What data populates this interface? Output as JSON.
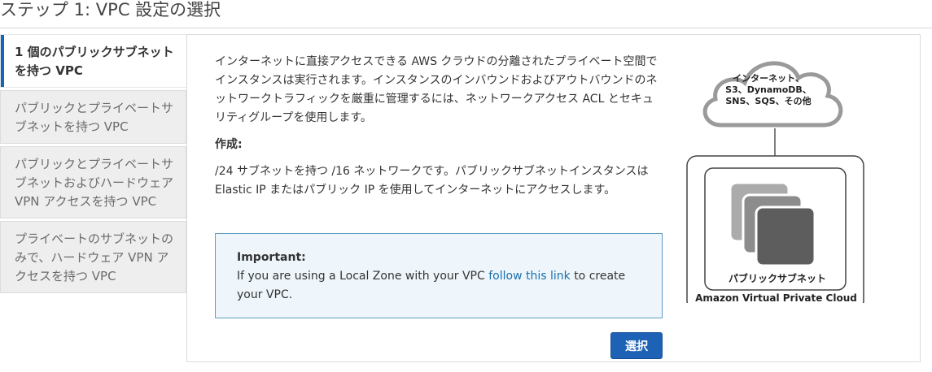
{
  "page": {
    "title": "ステップ 1: VPC 設定の選択"
  },
  "sidebar": {
    "items": [
      {
        "label": "1 個のパブリックサブネットを持つ VPC",
        "active": true
      },
      {
        "label": "パブリックとプライベートサブネットを持つ VPC",
        "active": false
      },
      {
        "label": "パブリックとプライベートサブネットおよびハードウェア VPN アクセスを持つ VPC",
        "active": false
      },
      {
        "label": "プライベートのサブネットのみで、ハードウェア VPN アクセスを持つ VPC",
        "active": false
      }
    ]
  },
  "main": {
    "description": "インターネットに直接アクセスできる AWS クラウドの分離されたプライベート空間でインスタンスは実行されます。インスタンスのインバウンドおよびアウトバウンドのネットワークトラフィックを厳重に管理するには、ネットワークアクセス ACL とセキュリティグループを使用します。",
    "create_label": "作成:",
    "create_text": "/24 サブネットを持つ /16 ネットワークです。パブリックサブネットインスタンスは Elastic IP またはパブリック IP を使用してインターネットにアクセスします。",
    "notice": {
      "heading": "Important:",
      "text_before": "If you are using a Local Zone with your VPC",
      "link": "follow this link",
      "text_after": "to create your VPC."
    },
    "select_button": "選択"
  },
  "diagram": {
    "cloud_line1": "インターネット、",
    "cloud_line2": "S3、DynamoDB、",
    "cloud_line3": "SNS、SQS、その他",
    "subnet_label": "パブリックサブネット",
    "vpc_label": "Amazon Virtual Private Cloud"
  },
  "colors": {
    "accent": "#1166bb",
    "button": "#1e62b5",
    "link": "#1a6fad",
    "notice_bg": "#eef6fb",
    "notice_border": "#5f9cc5"
  }
}
